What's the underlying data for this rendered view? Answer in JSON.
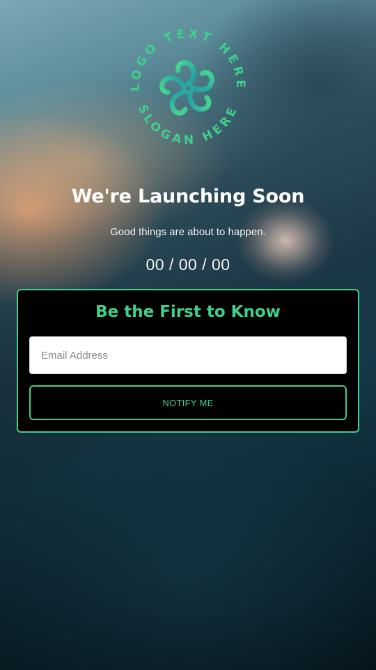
{
  "logo": {
    "top_text": "LOGO TEXT HERE",
    "bottom_text": "SLOGAN HERE",
    "colors": {
      "primary": "#3fcf8e",
      "secondary": "#2aa7a0"
    }
  },
  "hero": {
    "title": "We're Launching Soon",
    "subtitle": "Good things are about to happen.",
    "countdown": "00 / 00 / 00"
  },
  "signup": {
    "title": "Be the First to Know",
    "email_placeholder": "Email Address",
    "email_value": "",
    "button_label": "NOTIFY ME"
  },
  "colors": {
    "accent": "#3fcf8e",
    "panel_background": "#000000"
  }
}
